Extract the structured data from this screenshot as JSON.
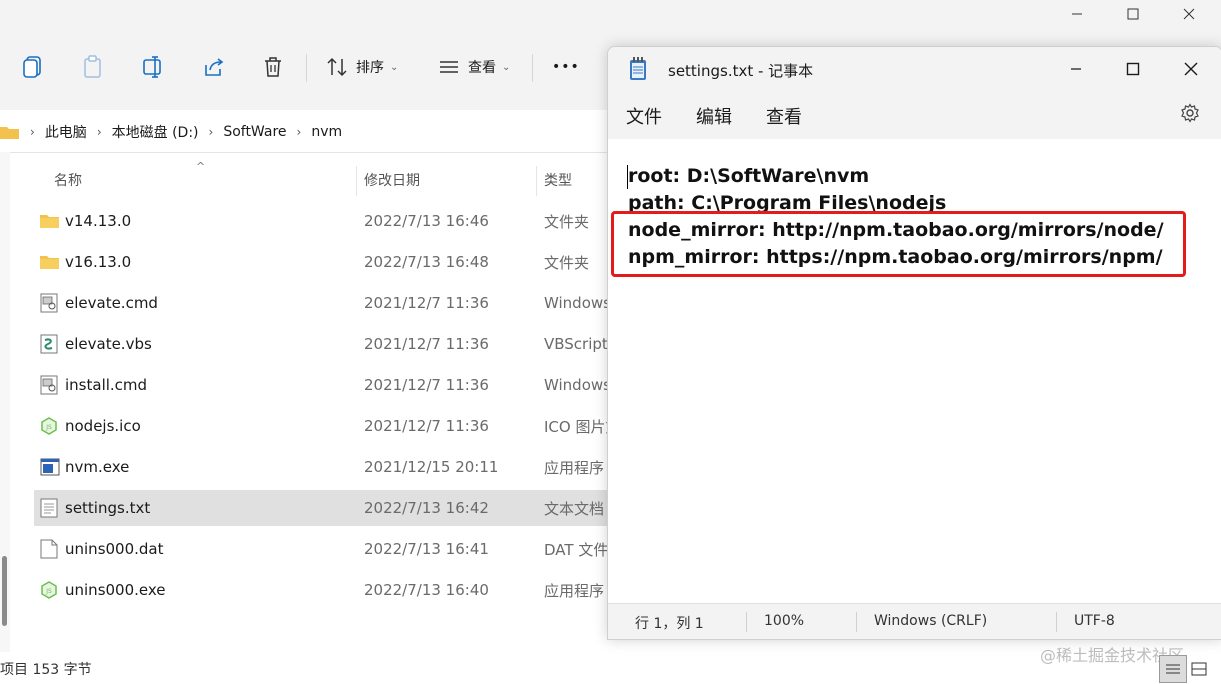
{
  "explorer": {
    "toolbar": {
      "sort_label": "排序",
      "view_label": "查看",
      "more_label": "•••"
    },
    "breadcrumb": [
      "此电脑",
      "本地磁盘 (D:)",
      "SoftWare",
      "nvm"
    ],
    "columns": {
      "name": "名称",
      "date": "修改日期",
      "type": "类型"
    },
    "files": [
      {
        "name": "v14.13.0",
        "date": "2022/7/13 16:46",
        "type": "文件夹",
        "icon": "folder-icon"
      },
      {
        "name": "v16.13.0",
        "date": "2022/7/13 16:48",
        "type": "文件夹",
        "icon": "folder-icon"
      },
      {
        "name": "elevate.cmd",
        "date": "2021/12/7 11:36",
        "type": "Windows",
        "icon": "cmd-file-icon"
      },
      {
        "name": "elevate.vbs",
        "date": "2021/12/7 11:36",
        "type": "VBScript",
        "icon": "vbs-file-icon"
      },
      {
        "name": "install.cmd",
        "date": "2021/12/7 11:36",
        "type": "Windows",
        "icon": "cmd-file-icon"
      },
      {
        "name": "nodejs.ico",
        "date": "2021/12/7 11:36",
        "type": "ICO 图片文",
        "icon": "nodejs-icon"
      },
      {
        "name": "nvm.exe",
        "date": "2021/12/15 20:11",
        "type": "应用程序",
        "icon": "exe-file-icon"
      },
      {
        "name": "settings.txt",
        "date": "2022/7/13 16:42",
        "type": "文本文档",
        "icon": "text-file-icon",
        "selected": true
      },
      {
        "name": "unins000.dat",
        "date": "2022/7/13 16:41",
        "type": "DAT 文件",
        "icon": "blank-file-icon"
      },
      {
        "name": "unins000.exe",
        "date": "2022/7/13 16:40",
        "type": "应用程序",
        "icon": "nodejs-icon"
      }
    ],
    "status": "项目  153 字节",
    "watermark": "@稀土掘金技术社区"
  },
  "notepad": {
    "title": "settings.txt - 记事本",
    "menu": [
      "文件",
      "编辑",
      "查看"
    ],
    "lines": [
      "root: D:\\SoftWare\\nvm",
      "path: C:\\Program Files\\nodejs",
      "node_mirror: http://npm.taobao.org/mirrors/node/",
      "npm_mirror: https://npm.taobao.org/mirrors/npm/"
    ],
    "status": {
      "position": "行 1，列 1",
      "zoom": "100%",
      "line_ending": "Windows (CRLF)",
      "encoding": "UTF-8"
    }
  },
  "colors": {
    "highlight_border": "#e31b1b",
    "folder": "#f2c14e",
    "chrome_bg": "#f3f3f3",
    "selected_row": "#e0e0e0"
  }
}
